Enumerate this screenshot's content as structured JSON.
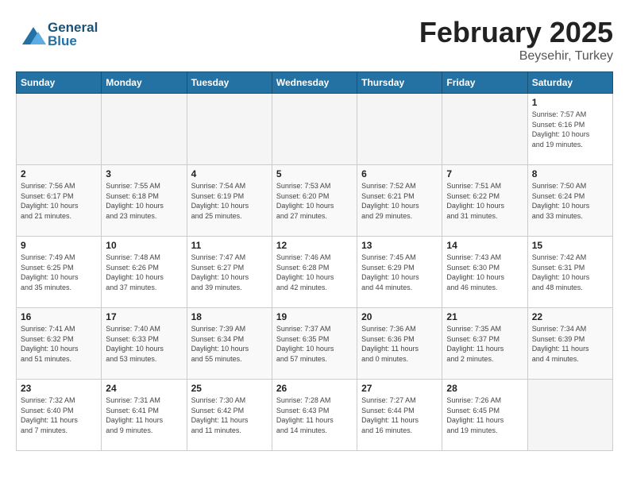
{
  "header": {
    "logo_line1": "General",
    "logo_line2": "Blue",
    "month_year": "February 2025",
    "location": "Beysehir, Turkey"
  },
  "weekdays": [
    "Sunday",
    "Monday",
    "Tuesday",
    "Wednesday",
    "Thursday",
    "Friday",
    "Saturday"
  ],
  "weeks": [
    [
      {
        "day": "",
        "info": ""
      },
      {
        "day": "",
        "info": ""
      },
      {
        "day": "",
        "info": ""
      },
      {
        "day": "",
        "info": ""
      },
      {
        "day": "",
        "info": ""
      },
      {
        "day": "",
        "info": ""
      },
      {
        "day": "1",
        "info": "Sunrise: 7:57 AM\nSunset: 6:16 PM\nDaylight: 10 hours\nand 19 minutes."
      }
    ],
    [
      {
        "day": "2",
        "info": "Sunrise: 7:56 AM\nSunset: 6:17 PM\nDaylight: 10 hours\nand 21 minutes."
      },
      {
        "day": "3",
        "info": "Sunrise: 7:55 AM\nSunset: 6:18 PM\nDaylight: 10 hours\nand 23 minutes."
      },
      {
        "day": "4",
        "info": "Sunrise: 7:54 AM\nSunset: 6:19 PM\nDaylight: 10 hours\nand 25 minutes."
      },
      {
        "day": "5",
        "info": "Sunrise: 7:53 AM\nSunset: 6:20 PM\nDaylight: 10 hours\nand 27 minutes."
      },
      {
        "day": "6",
        "info": "Sunrise: 7:52 AM\nSunset: 6:21 PM\nDaylight: 10 hours\nand 29 minutes."
      },
      {
        "day": "7",
        "info": "Sunrise: 7:51 AM\nSunset: 6:22 PM\nDaylight: 10 hours\nand 31 minutes."
      },
      {
        "day": "8",
        "info": "Sunrise: 7:50 AM\nSunset: 6:24 PM\nDaylight: 10 hours\nand 33 minutes."
      }
    ],
    [
      {
        "day": "9",
        "info": "Sunrise: 7:49 AM\nSunset: 6:25 PM\nDaylight: 10 hours\nand 35 minutes."
      },
      {
        "day": "10",
        "info": "Sunrise: 7:48 AM\nSunset: 6:26 PM\nDaylight: 10 hours\nand 37 minutes."
      },
      {
        "day": "11",
        "info": "Sunrise: 7:47 AM\nSunset: 6:27 PM\nDaylight: 10 hours\nand 39 minutes."
      },
      {
        "day": "12",
        "info": "Sunrise: 7:46 AM\nSunset: 6:28 PM\nDaylight: 10 hours\nand 42 minutes."
      },
      {
        "day": "13",
        "info": "Sunrise: 7:45 AM\nSunset: 6:29 PM\nDaylight: 10 hours\nand 44 minutes."
      },
      {
        "day": "14",
        "info": "Sunrise: 7:43 AM\nSunset: 6:30 PM\nDaylight: 10 hours\nand 46 minutes."
      },
      {
        "day": "15",
        "info": "Sunrise: 7:42 AM\nSunset: 6:31 PM\nDaylight: 10 hours\nand 48 minutes."
      }
    ],
    [
      {
        "day": "16",
        "info": "Sunrise: 7:41 AM\nSunset: 6:32 PM\nDaylight: 10 hours\nand 51 minutes."
      },
      {
        "day": "17",
        "info": "Sunrise: 7:40 AM\nSunset: 6:33 PM\nDaylight: 10 hours\nand 53 minutes."
      },
      {
        "day": "18",
        "info": "Sunrise: 7:39 AM\nSunset: 6:34 PM\nDaylight: 10 hours\nand 55 minutes."
      },
      {
        "day": "19",
        "info": "Sunrise: 7:37 AM\nSunset: 6:35 PM\nDaylight: 10 hours\nand 57 minutes."
      },
      {
        "day": "20",
        "info": "Sunrise: 7:36 AM\nSunset: 6:36 PM\nDaylight: 11 hours\nand 0 minutes."
      },
      {
        "day": "21",
        "info": "Sunrise: 7:35 AM\nSunset: 6:37 PM\nDaylight: 11 hours\nand 2 minutes."
      },
      {
        "day": "22",
        "info": "Sunrise: 7:34 AM\nSunset: 6:39 PM\nDaylight: 11 hours\nand 4 minutes."
      }
    ],
    [
      {
        "day": "23",
        "info": "Sunrise: 7:32 AM\nSunset: 6:40 PM\nDaylight: 11 hours\nand 7 minutes."
      },
      {
        "day": "24",
        "info": "Sunrise: 7:31 AM\nSunset: 6:41 PM\nDaylight: 11 hours\nand 9 minutes."
      },
      {
        "day": "25",
        "info": "Sunrise: 7:30 AM\nSunset: 6:42 PM\nDaylight: 11 hours\nand 11 minutes."
      },
      {
        "day": "26",
        "info": "Sunrise: 7:28 AM\nSunset: 6:43 PM\nDaylight: 11 hours\nand 14 minutes."
      },
      {
        "day": "27",
        "info": "Sunrise: 7:27 AM\nSunset: 6:44 PM\nDaylight: 11 hours\nand 16 minutes."
      },
      {
        "day": "28",
        "info": "Sunrise: 7:26 AM\nSunset: 6:45 PM\nDaylight: 11 hours\nand 19 minutes."
      },
      {
        "day": "",
        "info": ""
      }
    ]
  ]
}
